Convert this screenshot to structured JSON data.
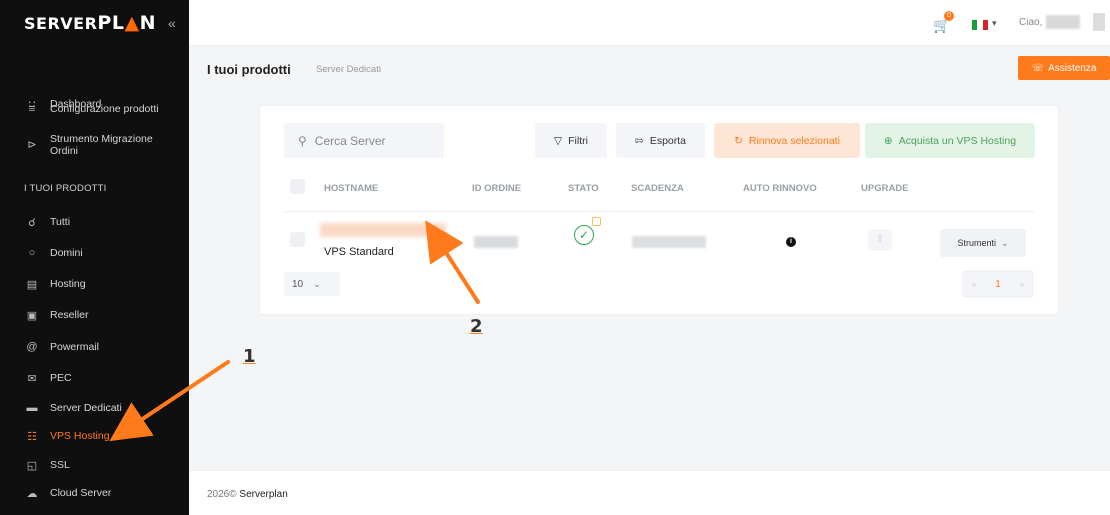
{
  "brand": {
    "logo_left": "SERVER",
    "logo_right": "PLAN",
    "collapse_glyph": "«"
  },
  "sidebar": {
    "top_items": [
      {
        "label": "Dashboard",
        "icon": "grid-icon"
      },
      {
        "label": "Configurazione prodotti",
        "icon": "sliders-icon"
      },
      {
        "label": "Strumento Migrazione Ordini",
        "icon": "migrate-icon"
      }
    ],
    "section_label": "I TUOI PRODOTTI",
    "product_items": [
      {
        "label": "Tutti",
        "icon": "globe-icon"
      },
      {
        "label": "Domini",
        "icon": "domain-icon"
      },
      {
        "label": "Hosting",
        "icon": "server-icon"
      },
      {
        "label": "Reseller",
        "icon": "reseller-icon"
      },
      {
        "label": "Powermail",
        "icon": "at-icon"
      },
      {
        "label": "PEC",
        "icon": "mail-icon"
      },
      {
        "label": "Server Dedicati",
        "icon": "rack-icon"
      },
      {
        "label": "VPS Hosting",
        "icon": "vps-icon",
        "active": true
      },
      {
        "label": "SSL",
        "icon": "lock-icon"
      },
      {
        "label": "Cloud Server",
        "icon": "cloud-icon"
      }
    ]
  },
  "topbar": {
    "cart_count": "0",
    "greeting": "Ciao,",
    "flag_colors": [
      "#1a9b3c",
      "#ffffff",
      "#d8202a"
    ]
  },
  "header": {
    "title": "I tuoi prodotti",
    "breadcrumb": "Server Dedicati",
    "assist_label": "Assistenza"
  },
  "toolbar": {
    "search_placeholder": "Cerca Server",
    "filtri": "Filtri",
    "esporta": "Esporta",
    "rinnova": "Rinnova selezionati",
    "acquista": "Acquista un VPS Hosting"
  },
  "table": {
    "columns": [
      "HOSTNAME",
      "ID ORDINE",
      "STATO",
      "SCADENZA",
      "AUTO RINNOVO",
      "UPGRADE"
    ],
    "rows": [
      {
        "hostname_sub": "VPS Standard",
        "strumenti": "Strumenti"
      }
    ]
  },
  "pagination": {
    "page_size": "10",
    "prev": "«",
    "current": "1",
    "next": "»"
  },
  "footer": {
    "year": "2026©",
    "company": "Serverplan"
  },
  "annotations": {
    "one": "1",
    "two": "2"
  },
  "colors": {
    "accent": "#ff7a1a",
    "sidebar_bg": "#0f0f10",
    "success": "#2ea84a"
  }
}
